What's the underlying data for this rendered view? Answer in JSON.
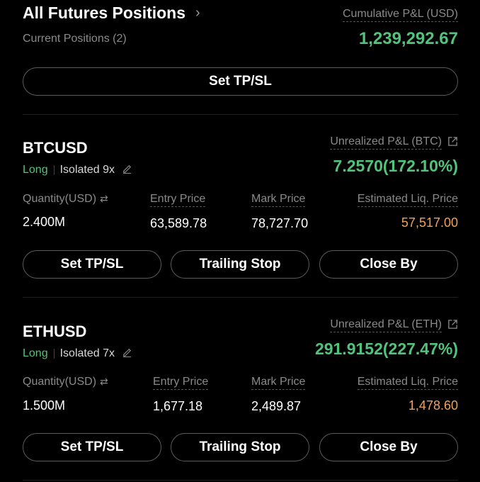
{
  "header": {
    "title": "All Futures Positions",
    "subtitle": "Current Positions (2)",
    "cumulative_label": "Cumulative P&L (USD)",
    "cumulative_value": "1,239,292.67",
    "set_tpsl": "Set TP/SL"
  },
  "positions": [
    {
      "symbol": "BTCUSD",
      "side": "Long",
      "margin": "Isolated 9x",
      "upl_label": "Unrealized P&L (BTC)",
      "upl_value": "7.2570(172.10%)",
      "quantity_label": "Quantity(USD)",
      "quantity": "2.400M",
      "entry_label": "Entry Price",
      "entry": "63,589.78",
      "mark_label": "Mark Price",
      "mark": "78,727.70",
      "liq_label": "Estimated Liq. Price",
      "liq": "57,517.00",
      "btn_tpsl": "Set TP/SL",
      "btn_trailing": "Trailing Stop",
      "btn_close": "Close By"
    },
    {
      "symbol": "ETHUSD",
      "side": "Long",
      "margin": "Isolated 7x",
      "upl_label": "Unrealized P&L (ETH)",
      "upl_value": "291.9152(227.47%)",
      "quantity_label": "Quantity(USD)",
      "quantity": "1.500M",
      "entry_label": "Entry Price",
      "entry": "1,677.18",
      "mark_label": "Mark Price",
      "mark": "2,489.87",
      "liq_label": "Estimated Liq. Price",
      "liq": "1,478.60",
      "btn_tpsl": "Set TP/SL",
      "btn_trailing": "Trailing Stop",
      "btn_close": "Close By"
    }
  ],
  "colors": {
    "profit_green": "#52c37a",
    "liq_orange": "#f0a25c",
    "muted_gray": "#8a8a8a",
    "background": "#000000"
  },
  "icons": {
    "title_chevron": "chevron-right-icon",
    "edit": "pencil-icon",
    "share": "external-link-icon",
    "swap": "swap-icon"
  }
}
